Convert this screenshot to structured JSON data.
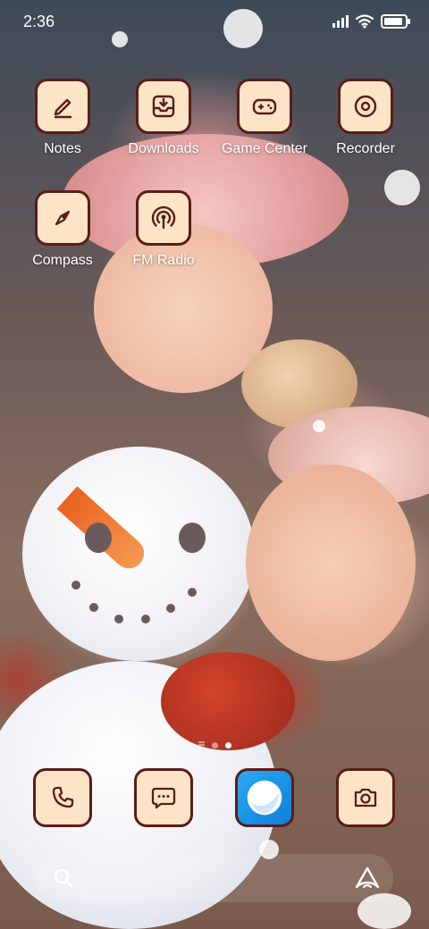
{
  "status_bar": {
    "time": "2:36",
    "icons": [
      "signal-icon",
      "wifi-icon",
      "battery-icon"
    ]
  },
  "apps": [
    {
      "label": "Notes",
      "icon": "pencil-icon"
    },
    {
      "label": "Downloads",
      "icon": "download-tray-icon"
    },
    {
      "label": "Game Center",
      "icon": "gamepad-icon"
    },
    {
      "label": "Recorder",
      "icon": "record-icon"
    },
    {
      "label": "Compass",
      "icon": "compass-icon"
    },
    {
      "label": "FM Radio",
      "icon": "radio-broadcast-icon"
    }
  ],
  "page_indicator": {
    "pages": 2,
    "active_page": 2
  },
  "dock": [
    {
      "name": "phone",
      "icon": "phone-icon"
    },
    {
      "name": "messages",
      "icon": "message-bubble-icon"
    },
    {
      "name": "browser",
      "icon": "browser-orb-icon"
    },
    {
      "name": "camera",
      "icon": "camera-icon"
    }
  ],
  "search_bar": {
    "left_icon": "search-icon",
    "right_icon": "assistant-icon"
  },
  "colors": {
    "icon_background": "#fde4c6",
    "icon_border": "#5a1d19",
    "browser_icon": "#1a8fe6",
    "label_text": "#ffffff"
  }
}
